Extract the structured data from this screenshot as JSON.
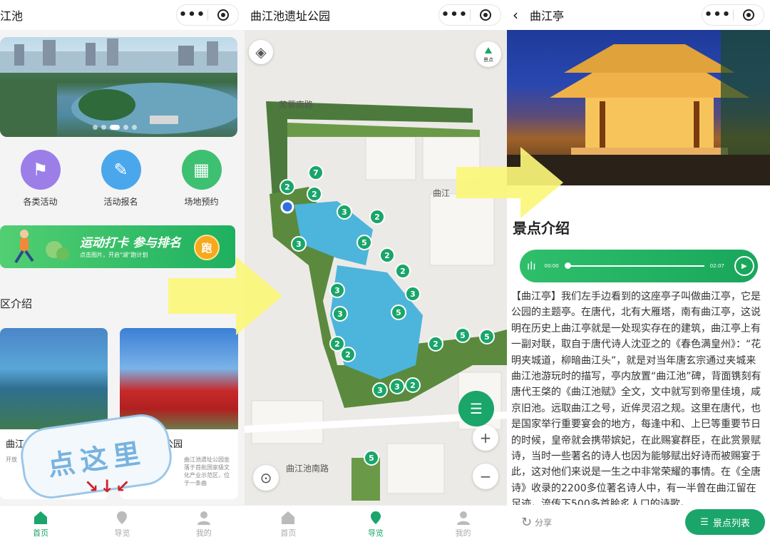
{
  "panel1": {
    "title": "江池",
    "quick": [
      {
        "label": "各类活动",
        "color": "#9c7ee8",
        "icon": "flag-icon"
      },
      {
        "label": "活动报名",
        "color": "#4aa7ec",
        "icon": "edit-icon"
      },
      {
        "label": "场地预约",
        "color": "#3ec072",
        "icon": "field-icon"
      }
    ],
    "promo": {
      "title": "运动打卡 参与排名",
      "subtitle": "点击图片，开启\"湖\"跑计划",
      "badge": "跑"
    },
    "section_title": "区介绍",
    "cards": [
      {
        "title": "曲江",
        "desc": "开放"
      },
      {
        "title": "公园",
        "desc": "曲江池遗址公园坐落于首批国家级文化产业示范区，位于一条曲"
      }
    ],
    "stamp_text": "点这里",
    "tabs": [
      {
        "label": "首页",
        "icon": "home-icon"
      },
      {
        "label": "导览",
        "icon": "map-pin-icon"
      },
      {
        "label": "我的",
        "icon": "user-icon"
      }
    ]
  },
  "panel2": {
    "title": "曲江池遗址公园",
    "scenic_label": "景点",
    "roads": [
      "芙蓉南路",
      "曲江池南路",
      "曲江"
    ],
    "tabs": [
      {
        "label": "首页",
        "icon": "home-icon"
      },
      {
        "label": "导览",
        "icon": "map-pin-icon"
      },
      {
        "label": "我的",
        "icon": "user-icon"
      }
    ],
    "markers": [
      "7",
      "2",
      "2",
      "3",
      "2",
      "3",
      "5",
      "2",
      "2",
      "3",
      "3",
      "5",
      "3",
      "2",
      "2",
      "5",
      "5",
      "2",
      "3",
      "3",
      "2",
      "5"
    ]
  },
  "panel3": {
    "title": "曲江亭",
    "section_title": "景点介绍",
    "audio": {
      "current": "00:00",
      "total": "02:07"
    },
    "paragraph": "【曲江亭】我们左手边看到的这座亭子叫做曲江亭，它是公园的主题亭。在唐代，北有大雁塔，南有曲江亭，这说明在历史上曲江亭就是一处现实存在的建筑，曲江亭上有一副对联，取自于唐代诗人沈亚之的《春色满皇州》：“花明夹城道，柳暗曲江头”，就是对当年唐玄宗通过夹城来曲江池游玩时的描写，亭内放置“曲江池”碑，背面镌刻有唐代王棨的《曲江池赋》全文，文中就写到帝里佳境，咸京旧池。远取曲江之号，近侔灵沼之规。这里在唐代，也是国家举行重要宴会的地方，每逢中和、上巳等重要节日的时候，皇帝就会携带嫔妃，在此赐宴群臣，在此赏景赋诗，当时一些著名的诗人也因为能够赋出好诗而被赐宴于此，这对他们来说是一生之中非常荣耀的事情。在《全唐诗》收录的2200多位著名诗人中，有一半曾在曲江留在足迹，流传下500多首脍炙人口的诗歌。",
    "share_label": "分享",
    "list_label": "景点列表"
  },
  "colors": {
    "accent": "#1aa56a",
    "arrow": "#fbf67a"
  }
}
